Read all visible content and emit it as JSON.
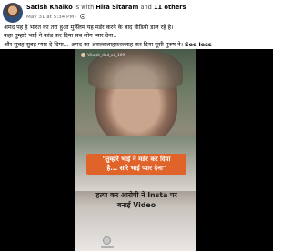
{
  "post": {
    "author": "Satish Khalko",
    "with_word": "is with",
    "tagged_person": "Hira Sitaram",
    "and_word": "and",
    "others": "11 others",
    "timestamp": "May 31 at 5:34 PM",
    "audience_icon": "globe-icon",
    "text_lines": [
      "अमद पह है भारत का तरा हुआ मुस्लिम यह मर्डर करने के बाद वीडियो डाल रहे है।",
      "कहा तुम्हारे भाई ने कांड कर दिया सब लोग प्यार देना..",
      "और सुबह सुबह प्यार दे दिया... अमद का असल्ललाहफ़रल्लाह कर दिया पूसी पुरुष ने।"
    ],
    "see_less": "See less"
  },
  "video": {
    "handle": "Vikash_dad_ak_109",
    "quote_lines": [
      "\"तुम्हारे भाई ने मर्डर कर दिया",
      "है... सारे भाई प्यार देना\""
    ],
    "headline_lines": [
      "हत्या कर आरोपी ने Insta पर",
      "बनाई Video"
    ]
  },
  "colors": {
    "quote_bg": "#e0632a",
    "background": "#000000",
    "text": "#050505",
    "muted": "#65676b"
  }
}
